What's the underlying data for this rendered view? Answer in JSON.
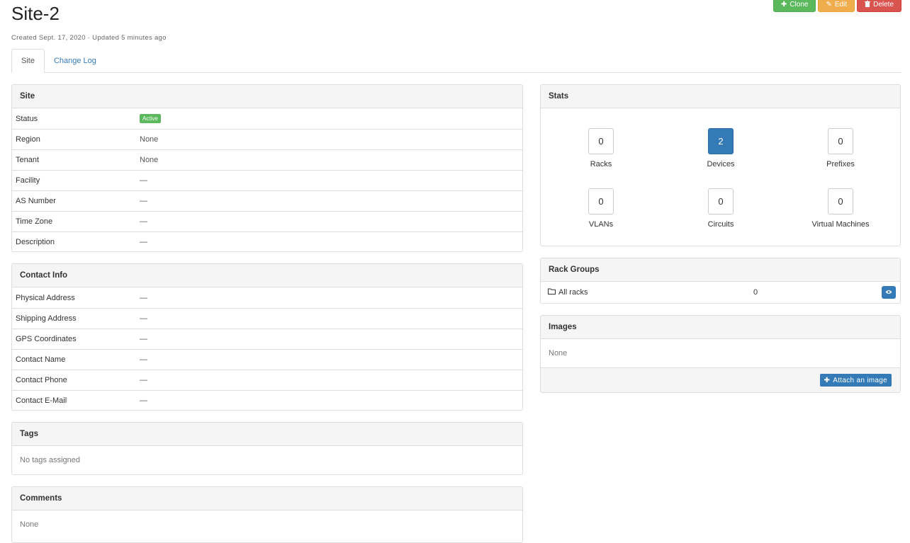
{
  "page": {
    "title": "Site-2",
    "subtitle": "Created Sept. 17, 2020 · Updated 5 minutes ago"
  },
  "actions": {
    "clone": "Clone",
    "edit": "Edit",
    "delete": "Delete"
  },
  "tabs": [
    {
      "label": "Site",
      "active": true
    },
    {
      "label": "Change Log",
      "active": false
    }
  ],
  "site_panel": {
    "title": "Site",
    "rows": [
      {
        "key": "Status",
        "value": "Active"
      },
      {
        "key": "Region",
        "value": "None"
      },
      {
        "key": "Tenant",
        "value": "None"
      },
      {
        "key": "Facility",
        "value": "—"
      },
      {
        "key": "AS Number",
        "value": "—"
      },
      {
        "key": "Time Zone",
        "value": "—"
      },
      {
        "key": "Description",
        "value": "—"
      }
    ]
  },
  "contact_panel": {
    "title": "Contact Info",
    "rows": [
      {
        "key": "Physical Address",
        "value": "—"
      },
      {
        "key": "Shipping Address",
        "value": "—"
      },
      {
        "key": "GPS Coordinates",
        "value": "—"
      },
      {
        "key": "Contact Name",
        "value": "—"
      },
      {
        "key": "Contact Phone",
        "value": "—"
      },
      {
        "key": "Contact E-Mail",
        "value": "—"
      }
    ]
  },
  "tags_panel": {
    "title": "Tags",
    "body": "No tags assigned"
  },
  "comments_panel": {
    "title": "Comments",
    "body": "None"
  },
  "stats_panel": {
    "title": "Stats",
    "items": [
      {
        "label": "Racks",
        "count": "0"
      },
      {
        "label": "Devices",
        "count": "2"
      },
      {
        "label": "Prefixes",
        "count": "0"
      },
      {
        "label": "VLANs",
        "count": "0"
      },
      {
        "label": "Circuits",
        "count": "0"
      },
      {
        "label": "Virtual Machines",
        "count": "0"
      }
    ]
  },
  "rack_groups_panel": {
    "title": "Rack Groups",
    "row": {
      "label": "All racks",
      "count": "0"
    }
  },
  "images_panel": {
    "title": "Images",
    "body": "None",
    "attach_label": "Attach an image"
  },
  "colors": {
    "success": "#5cb85c",
    "warning": "#f0ad4e",
    "danger": "#d9534f",
    "primary": "#337ab7"
  }
}
